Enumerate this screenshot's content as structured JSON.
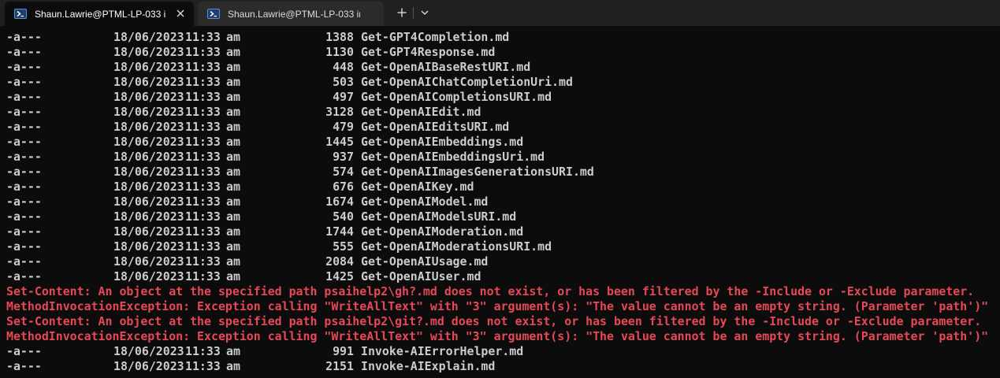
{
  "tabs": [
    {
      "label": "Shaun.Lawrie@PTML-LP-033 i",
      "active": true
    },
    {
      "label": "Shaun.Lawrie@PTML-LP-033 in",
      "active": false
    }
  ],
  "tab_buttons": {
    "new_tab": "+",
    "dropdown": "⌄"
  },
  "colors": {
    "error": "#e74856",
    "text": "#cccccc",
    "background": "#0c0c0c"
  },
  "files": [
    {
      "mode": "-a---",
      "date": "18/06/2023",
      "time": "11:33",
      "ampm": "am",
      "length": "1388",
      "name": "Get-GPT4Completion.md"
    },
    {
      "mode": "-a---",
      "date": "18/06/2023",
      "time": "11:33",
      "ampm": "am",
      "length": "1130",
      "name": "Get-GPT4Response.md"
    },
    {
      "mode": "-a---",
      "date": "18/06/2023",
      "time": "11:33",
      "ampm": "am",
      "length": "448",
      "name": "Get-OpenAIBaseRestURI.md"
    },
    {
      "mode": "-a---",
      "date": "18/06/2023",
      "time": "11:33",
      "ampm": "am",
      "length": "503",
      "name": "Get-OpenAIChatCompletionUri.md"
    },
    {
      "mode": "-a---",
      "date": "18/06/2023",
      "time": "11:33",
      "ampm": "am",
      "length": "497",
      "name": "Get-OpenAICompletionsURI.md"
    },
    {
      "mode": "-a---",
      "date": "18/06/2023",
      "time": "11:33",
      "ampm": "am",
      "length": "3128",
      "name": "Get-OpenAIEdit.md"
    },
    {
      "mode": "-a---",
      "date": "18/06/2023",
      "time": "11:33",
      "ampm": "am",
      "length": "479",
      "name": "Get-OpenAIEditsURI.md"
    },
    {
      "mode": "-a---",
      "date": "18/06/2023",
      "time": "11:33",
      "ampm": "am",
      "length": "1445",
      "name": "Get-OpenAIEmbeddings.md"
    },
    {
      "mode": "-a---",
      "date": "18/06/2023",
      "time": "11:33",
      "ampm": "am",
      "length": "937",
      "name": "Get-OpenAIEmbeddingsUri.md"
    },
    {
      "mode": "-a---",
      "date": "18/06/2023",
      "time": "11:33",
      "ampm": "am",
      "length": "574",
      "name": "Get-OpenAIImagesGenerationsURI.md"
    },
    {
      "mode": "-a---",
      "date": "18/06/2023",
      "time": "11:33",
      "ampm": "am",
      "length": "676",
      "name": "Get-OpenAIKey.md"
    },
    {
      "mode": "-a---",
      "date": "18/06/2023",
      "time": "11:33",
      "ampm": "am",
      "length": "1674",
      "name": "Get-OpenAIModel.md"
    },
    {
      "mode": "-a---",
      "date": "18/06/2023",
      "time": "11:33",
      "ampm": "am",
      "length": "540",
      "name": "Get-OpenAIModelsURI.md"
    },
    {
      "mode": "-a---",
      "date": "18/06/2023",
      "time": "11:33",
      "ampm": "am",
      "length": "1744",
      "name": "Get-OpenAIModeration.md"
    },
    {
      "mode": "-a---",
      "date": "18/06/2023",
      "time": "11:33",
      "ampm": "am",
      "length": "555",
      "name": "Get-OpenAIModerationsURI.md"
    },
    {
      "mode": "-a---",
      "date": "18/06/2023",
      "time": "11:33",
      "ampm": "am",
      "length": "2084",
      "name": "Get-OpenAIUsage.md"
    },
    {
      "mode": "-a---",
      "date": "18/06/2023",
      "time": "11:33",
      "ampm": "am",
      "length": "1425",
      "name": "Get-OpenAIUser.md"
    }
  ],
  "errors": [
    "Set-Content: An object at the specified path psaihelp2\\gh?.md does not exist, or has been filtered by the -Include or -Exclude parameter.",
    "MethodInvocationException: Exception calling \"WriteAllText\" with \"3\" argument(s): \"The value cannot be an empty string. (Parameter 'path')\"",
    "Set-Content: An object at the specified path psaihelp2\\git?.md does not exist, or has been filtered by the -Include or -Exclude parameter.",
    "MethodInvocationException: Exception calling \"WriteAllText\" with \"3\" argument(s): \"The value cannot be an empty string. (Parameter 'path')\""
  ],
  "files_after": [
    {
      "mode": "-a---",
      "date": "18/06/2023",
      "time": "11:33",
      "ampm": "am",
      "length": "991",
      "name": "Invoke-AIErrorHelper.md"
    },
    {
      "mode": "-a---",
      "date": "18/06/2023",
      "time": "11:33",
      "ampm": "am",
      "length": "2151",
      "name": "Invoke-AIExplain.md"
    }
  ]
}
